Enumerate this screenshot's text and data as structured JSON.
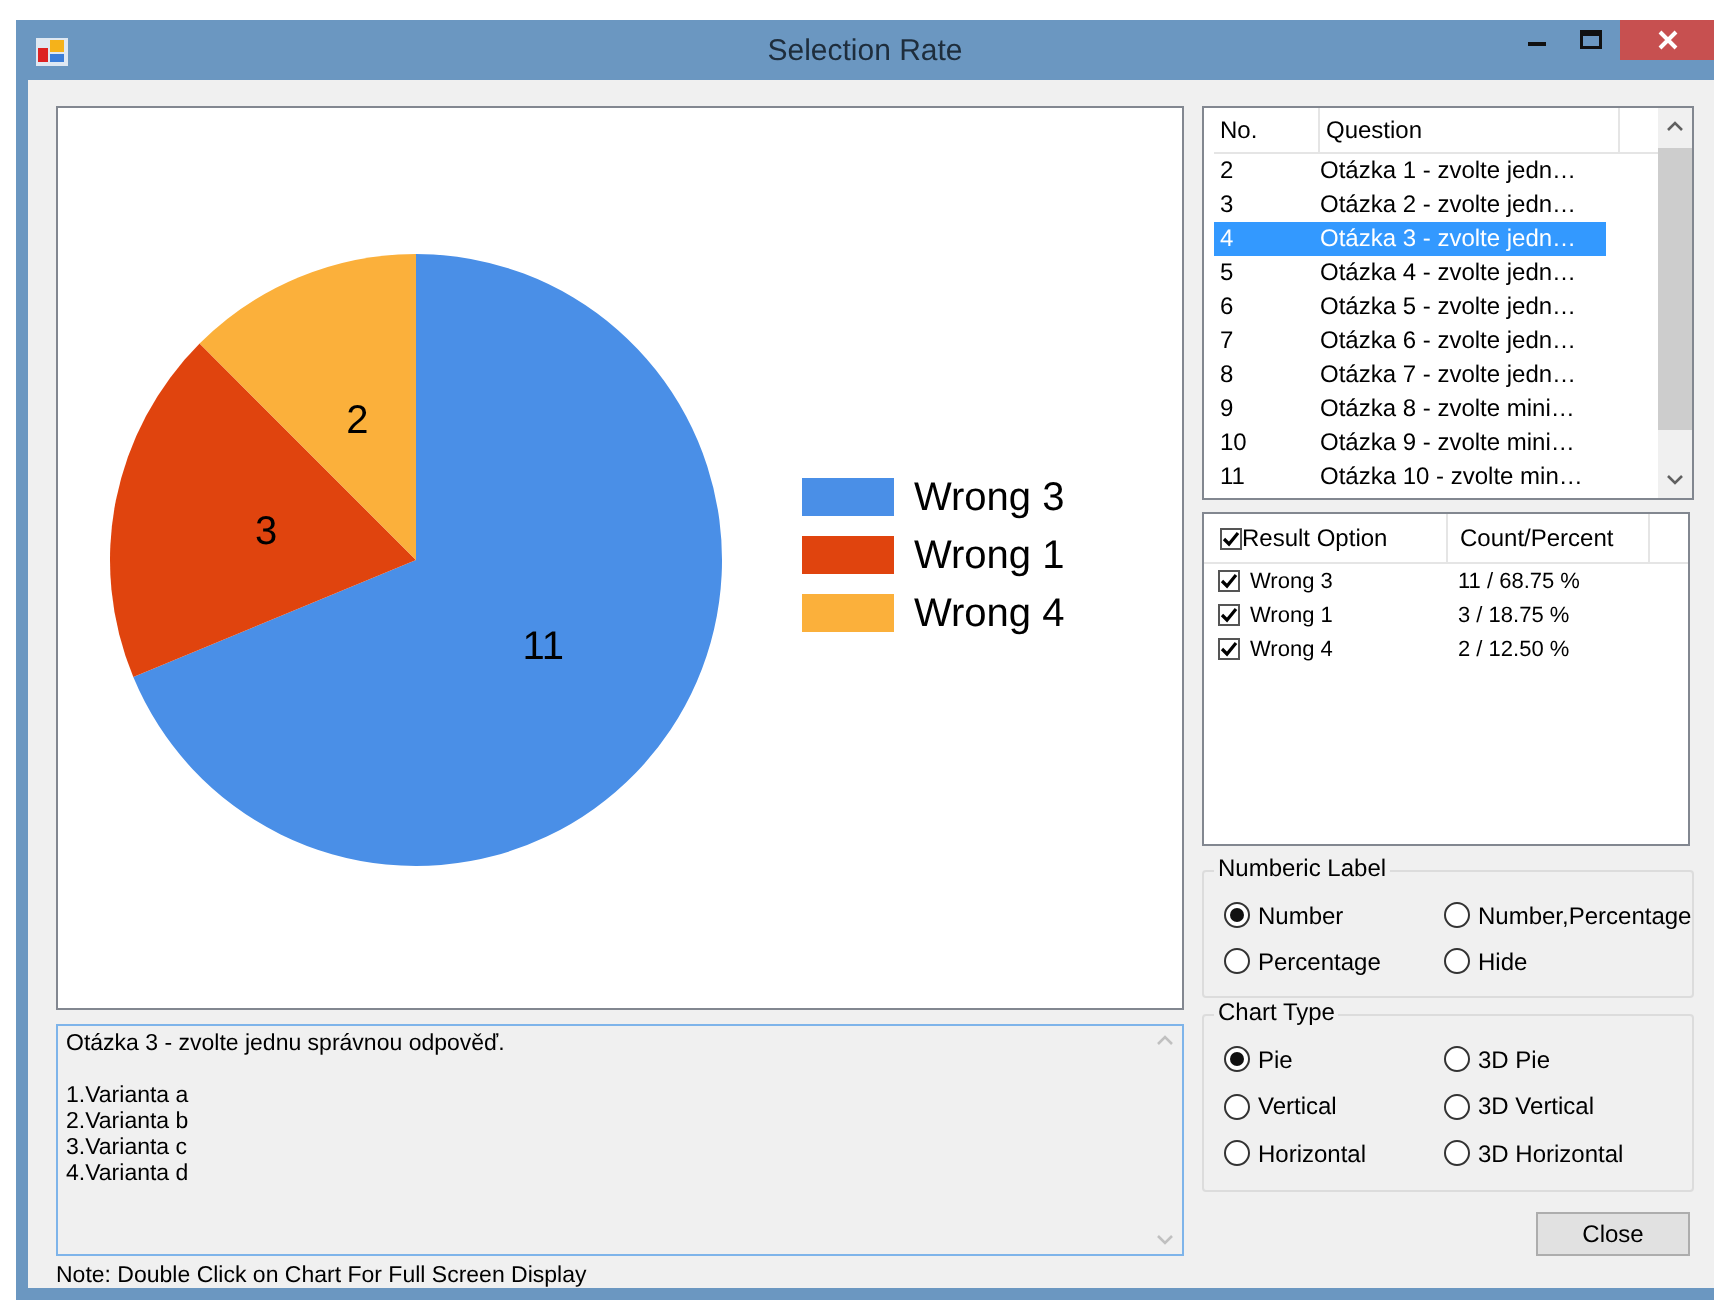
{
  "window": {
    "title": "Selection Rate"
  },
  "chart": {
    "chart_data": {
      "type": "pie",
      "categories": [
        "Wrong 3",
        "Wrong 1",
        "Wrong 4"
      ],
      "values": [
        11,
        3,
        2
      ],
      "data_labels": true,
      "legend": true
    },
    "slices": [
      {
        "color": "#4a8fe7"
      },
      {
        "color": "#e0440e"
      },
      {
        "color": "#fbb03b"
      }
    ]
  },
  "question_text": "Otázka 3 - zvolte jednu správnou odpověď.\n\n1.Varianta a\n2.Varianta b\n3.Varianta c\n4.Varianta d",
  "note": "Note: Double Click on Chart For Full Screen Display",
  "question_list": {
    "columns": [
      "No.",
      "Question"
    ],
    "rows": [
      {
        "no": "2",
        "question": "Otázka 1 - zvolte jedn…",
        "selected": false
      },
      {
        "no": "3",
        "question": "Otázka 2 - zvolte jedn…",
        "selected": false
      },
      {
        "no": "4",
        "question": "Otázka 3 - zvolte jedn…",
        "selected": true
      },
      {
        "no": "5",
        "question": "Otázka 4 - zvolte jedn…",
        "selected": false
      },
      {
        "no": "6",
        "question": "Otázka 5 - zvolte jedn…",
        "selected": false
      },
      {
        "no": "7",
        "question": "Otázka 6 - zvolte jedn…",
        "selected": false
      },
      {
        "no": "8",
        "question": "Otázka 7 - zvolte jedn…",
        "selected": false
      },
      {
        "no": "9",
        "question": "Otázka 8 - zvolte mini…",
        "selected": false
      },
      {
        "no": "10",
        "question": "Otázka 9 - zvolte mini…",
        "selected": false
      },
      {
        "no": "11",
        "question": "Otázka 10 - zvolte min…",
        "selected": false
      }
    ]
  },
  "result_list": {
    "header_checked": true,
    "columns": [
      "Result Option",
      "Count/Percent"
    ],
    "rows": [
      {
        "option": "Wrong 3",
        "value": "11 / 68.75 %",
        "checked": true
      },
      {
        "option": "Wrong 1",
        "value": "3 / 18.75 %",
        "checked": true
      },
      {
        "option": "Wrong 4",
        "value": "2 / 12.50 %",
        "checked": true
      }
    ]
  },
  "numeric_label": {
    "title": "Numberic Label",
    "options": [
      {
        "label": "Number",
        "selected": true
      },
      {
        "label": "Number,Percentage",
        "selected": false
      },
      {
        "label": "Percentage",
        "selected": false
      },
      {
        "label": "Hide",
        "selected": false
      }
    ]
  },
  "chart_type": {
    "title": "Chart Type",
    "options": [
      {
        "label": "Pie",
        "selected": true
      },
      {
        "label": "3D Pie",
        "selected": false
      },
      {
        "label": "Vertical",
        "selected": false
      },
      {
        "label": "3D Vertical",
        "selected": false
      },
      {
        "label": "Horizontal",
        "selected": false
      },
      {
        "label": "3D Horizontal",
        "selected": false
      }
    ]
  },
  "close_button": "Close"
}
